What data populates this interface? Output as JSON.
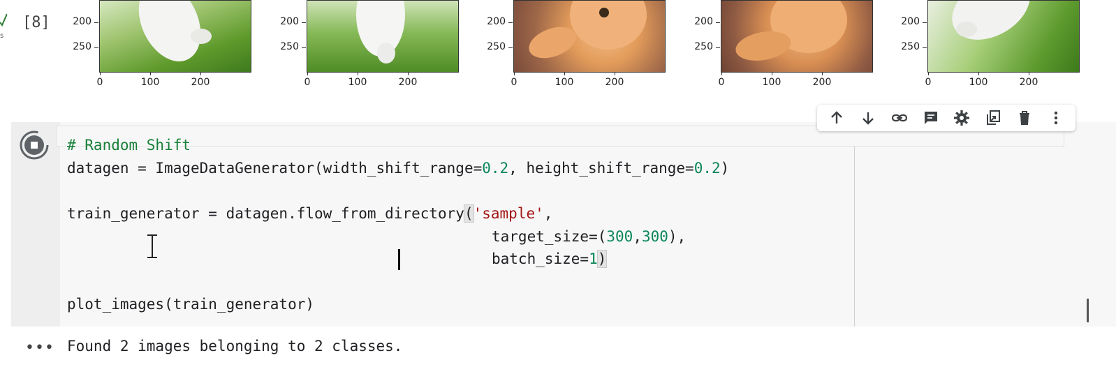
{
  "previous_cell": {
    "exec_count": "[8]",
    "exec_time": "s",
    "y_ticks": [
      "200",
      "250"
    ],
    "x_ticks": [
      "0",
      "100",
      "200"
    ],
    "plots": [
      "dog",
      "dog",
      "cat",
      "cat",
      "dog"
    ]
  },
  "toolbar": {
    "items": [
      "move-up",
      "move-down",
      "link",
      "comment",
      "settings",
      "mirror-in-tab",
      "delete",
      "more"
    ]
  },
  "cell": {
    "lines": {
      "l1": "# Random Shift",
      "l2a": "datagen = ImageDataGenerator(width_shift_range=",
      "l2b": "0.2",
      "l2c": ", height_shift_range=",
      "l2d": "0.2",
      "l2e": ")",
      "l3a": "train_generator = datagen.flow_from_directory",
      "l3b": "(",
      "l3c": "'sample'",
      "l3d": ",",
      "l4a": "target_size=(",
      "l4b": "300",
      "l4c": ",",
      "l4d": "300",
      "l4e": "),",
      "l5a": "batch_size=",
      "l5b": "1",
      "l5c": ")",
      "l6": "plot_images(train_generator)"
    }
  },
  "output": {
    "more": "•••",
    "text": "Found 2 images belonging to 2 classes."
  },
  "colors": {
    "comment": "#188038",
    "number": "#098658",
    "string": "#a31515"
  }
}
